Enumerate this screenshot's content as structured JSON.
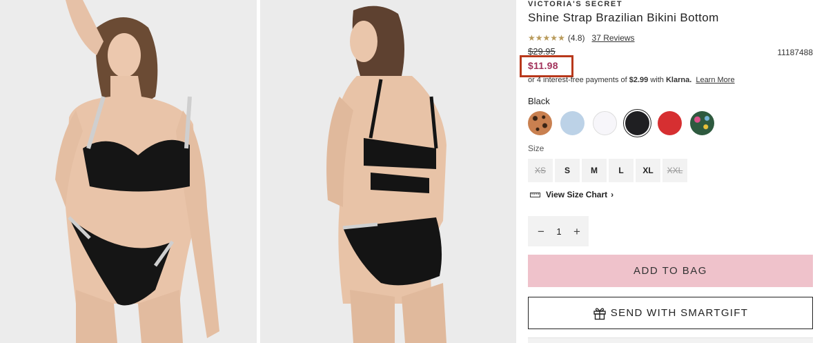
{
  "product": {
    "brand": "VICTORIA'S SECRET",
    "title": "Shine Strap Brazilian Bikini Bottom",
    "rating_value": "(4.8)",
    "stars": 5,
    "reviews_label": "37 Reviews",
    "original_price": "$29.95",
    "sale_price": "$11.98",
    "sku": "11187488",
    "klarna": {
      "prefix": "or 4 interest-free payments of",
      "amount": "$2.99",
      "with": "with",
      "brand": "Klarna.",
      "learn_more": "Learn More"
    }
  },
  "colors": {
    "selected_label": "Black",
    "swatches": [
      {
        "name": "leopard",
        "fill": "#b5723f"
      },
      {
        "name": "light-blue",
        "fill": "#bcd2e7"
      },
      {
        "name": "white",
        "fill": "#f7f6fa"
      },
      {
        "name": "black",
        "fill": "#1f1f22"
      },
      {
        "name": "red",
        "fill": "#d62f31"
      },
      {
        "name": "tropical-print",
        "fill": "#3b6b4e"
      }
    ]
  },
  "size": {
    "label": "Size",
    "options": [
      {
        "label": "XS",
        "available": false
      },
      {
        "label": "S",
        "available": true
      },
      {
        "label": "M",
        "available": true
      },
      {
        "label": "L",
        "available": true
      },
      {
        "label": "XL",
        "available": true
      },
      {
        "label": "XXL",
        "available": false
      }
    ],
    "chart_link": "View Size Chart",
    "chart_chevron": "›"
  },
  "quantity": {
    "minus": "−",
    "value": "1",
    "plus": "+"
  },
  "actions": {
    "add_to_bag": "ADD TO BAG",
    "send_gift": "SEND WITH SMARTGIFT"
  },
  "colors_theme": {
    "accent_sale": "#a2315a",
    "add_to_bag_bg": "#efc2cb",
    "highlight_box": "#b8381b"
  }
}
